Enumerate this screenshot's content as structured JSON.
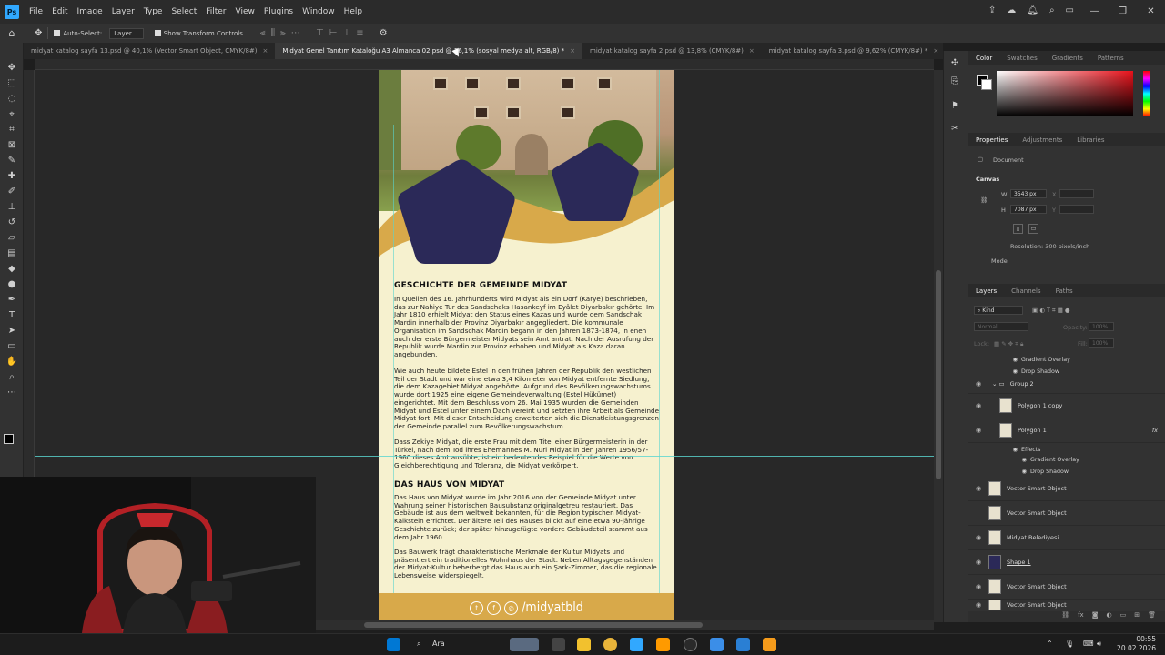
{
  "menu": {
    "app_icon": "Ps",
    "items": [
      "File",
      "Edit",
      "Image",
      "Layer",
      "Type",
      "Select",
      "Filter",
      "View",
      "Plugins",
      "Window",
      "Help"
    ]
  },
  "options": {
    "auto_select_label": "Auto-Select:",
    "auto_select_target": "Layer",
    "show_transform_label": "Show Transform Controls"
  },
  "tabs": [
    {
      "label": "midyat katalog sayfa 13.psd @ 40,1% (Vector Smart Object, CMYK/8#)",
      "active": false
    },
    {
      "label": "Midyat Genel Tanıtım Kataloğu A3 Almanca 02.psd @ 16,1% (sosyal medya alt, RGB/8) *",
      "active": true
    },
    {
      "label": "midyat katalog sayfa 2.psd @ 13,8% (CMYK/8#)",
      "active": false
    },
    {
      "label": "midyat katalog sayfa 3.psd @ 9,62% (CMYK/8#) *",
      "active": false
    }
  ],
  "document": {
    "heading1": "GESCHICHTE DER GEMEINDE MIDYAT",
    "para1": "In Quellen des 16. Jahrhunderts wird Midyat als ein Dorf (Karye) beschrieben, das zur Nahiye Tur des Sandschaks Hasankeyf im Eyâlet Diyarbakır gehörte. Im Jahr 1810 erhielt Midyat den Status eines Kazas und wurde dem Sandschak Mardin innerhalb der Provinz Diyarbakır angegliedert. Die kommunale Organisation im Sandschak Mardin begann in den Jahren 1873-1874, in enen auch der erste Bürgermeister Midyats sein Amt antrat. Nach der Ausrufung der Republik wurde Mardin zur Provinz erhoben und Midyat als Kaza daran angebunden.",
    "para2": "Wie auch heute bildete Estel in den frühen Jahren der Republik den westlichen Teil der Stadt und war eine etwa 3,4 Kilometer von Midyat entfernte Siedlung, die dem Kazagebiet Midyat angehörte. Aufgrund des Bevölkerungswachstums wurde dort 1925 eine eigene Gemeindeverwaltung (Estel Hükümet) eingerichtet. Mit dem Beschluss vom 26. Mai 1935 wurden die Gemeinden Midyat und Estel unter einem Dach vereint und setzten ihre Arbeit als Gemeinde Midyat fort. Mit dieser Entscheidung erweiterten sich die Dienstleistungsgrenzen der Gemeinde parallel zum Bevölkerungswachstum.",
    "para3": "Dass Zekiye Midyat, die erste Frau mit dem Titel einer Bürgermeisterin in der Türkei, nach dem Tod ihres Ehemannes M. Nuri Midyat in den Jahren 1956/57-1960 dieses Amt ausübte, ist ein bedeutendes Beispiel für die Werte von Gleichberechtigung und Toleranz, die Midyat verkörpert.",
    "heading2": "DAS HAUS VON MIDYAT",
    "para4": "Das Haus von Midyat wurde im Jahr 2016 von der Gemeinde Midyat unter Wahrung seiner historischen Bausubstanz originalgetreu restauriert. Das Gebäude ist aus dem weltweit bekannten, für die Region typischen Midyat-Kalkstein errichtet. Der ältere Teil des Hauses blickt auf eine etwa 90-jährige Geschichte zurück; der später hinzugefügte vordere Gebäudeteil stammt aus dem Jahr 1960.",
    "para5": "Das Bauwerk trägt charakteristische Merkmale der Kultur Midyats und präsentiert ein traditionelles Wohnhaus der Stadt. Neben Alltagsgegenständen der Midyat-Kultur beherbergt das Haus auch ein Şark-Zimmer, das die regionale Lebensweise widerspiegelt.",
    "footer_handle": "/midyatbld"
  },
  "panels": {
    "color_tabs": [
      "Color",
      "Swatches",
      "Gradients",
      "Patterns"
    ],
    "props_tabs": [
      "Properties",
      "Adjustments",
      "Libraries"
    ],
    "doc_label": "Document",
    "canvas_label": "Canvas",
    "width_label": "W",
    "width_value": "3543 px",
    "height_label": "H",
    "height_value": "7087 px",
    "x_label": "X",
    "y_label": "Y",
    "resolution": "Resolution: 300 pixels/inch",
    "mode_label": "Mode",
    "layers_tabs": [
      "Layers",
      "Channels",
      "Paths"
    ],
    "kind_label": "Kind",
    "blend_mode": "Normal",
    "opacity_label": "Opacity:",
    "opacity_value": "100%",
    "lock_label": "Lock:",
    "fill_label": "Fill:",
    "fill_value": "100%"
  },
  "layers": {
    "fx1_a": "Gradient Overlay",
    "fx1_b": "Drop Shadow",
    "group2": "Group 2",
    "poly_copy": "Polygon 1 copy",
    "poly1": "Polygon 1",
    "fx_badge": "fx",
    "effects": "Effects",
    "fx2_a": "Gradient Overlay",
    "fx2_b": "Drop Shadow",
    "vso1": "Vector Smart Object",
    "vso2": "Vector Smart Object",
    "belediye": "Midyat Belediyesi",
    "shape1": "Shape 1",
    "vso3": "Vector Smart Object",
    "vso4": "Vector Smart Object"
  },
  "taskbar": {
    "search_label": "Ara",
    "time": "00:55",
    "date": "20.02.2026"
  },
  "colors": {
    "accent_blue": "#31a8ff",
    "polygon_navy": "#2b2958",
    "gold": "#d8a94a",
    "cream": "#f6f1cf"
  }
}
